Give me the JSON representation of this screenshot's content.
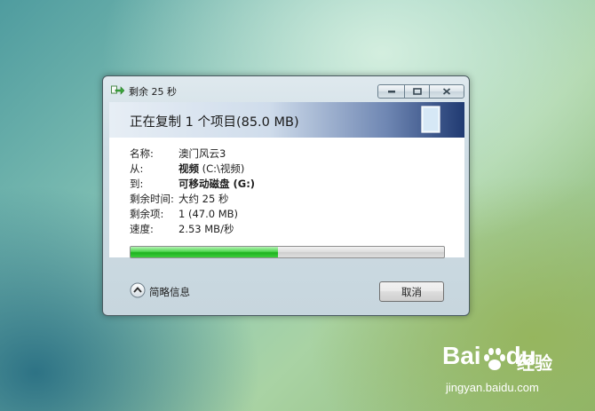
{
  "window": {
    "title": "剩余 25 秒",
    "header": "正在复制 1 个项目(85.0 MB)"
  },
  "details": [
    {
      "label": "名称:",
      "value": "澳门风云3",
      "value_bold": "",
      "value_rest": ""
    },
    {
      "label": "从:",
      "value": "",
      "value_bold": "视频",
      "value_rest": " (C:\\视频)"
    },
    {
      "label": "到:",
      "value": "",
      "value_bold": "可移动磁盘 (G:)",
      "value_rest": ""
    },
    {
      "label": "剩余时间:",
      "value": "大约 25 秒",
      "value_bold": "",
      "value_rest": ""
    },
    {
      "label": "剩余项:",
      "value": "1 (47.0 MB)",
      "value_bold": "",
      "value_rest": ""
    },
    {
      "label": "速度:",
      "value": "2.53 MB/秒",
      "value_bold": "",
      "value_rest": ""
    }
  ],
  "progress": {
    "fraction": 0.47
  },
  "footer": {
    "details_toggle_label": "简略信息",
    "cancel_label": "取消"
  },
  "watermark": {
    "logo": "Bai",
    "logo_tail": "du",
    "brand_cn": "经验",
    "url": "jingyan.baidu.com"
  },
  "colors": {
    "progress_fill": "#1eb21e",
    "header_gradient_end": "#203a72"
  }
}
